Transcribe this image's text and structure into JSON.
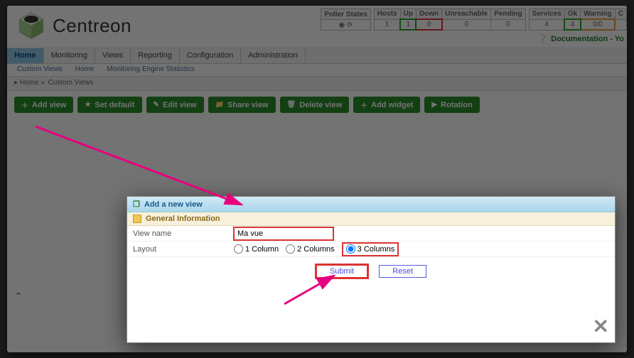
{
  "brand": "Centreon",
  "status": {
    "poller": {
      "header": "Poller States"
    },
    "hosts": {
      "h": "Hosts",
      "up": "Up",
      "down": "Down",
      "unreach": "Unreachable",
      "pending": "Pending",
      "v_hosts": "1",
      "v_up": "1",
      "v_down": "0",
      "v_unreach": "0",
      "v_pending": "0"
    },
    "svc": {
      "h": "Services",
      "ok": "Ok",
      "warn": "Warning",
      "crit": "C",
      "v_s": "4",
      "v_ok": "4",
      "v_warn": "0/0"
    }
  },
  "doclink": "Documentation - Yo",
  "nav": [
    "Home",
    "Monitoring",
    "Views",
    "Reporting",
    "Configuration",
    "Administration"
  ],
  "subnav": [
    "Custom Views",
    "Home",
    "Monitoring Engine Statistics"
  ],
  "crumb": {
    "a": "Home",
    "b": "Custom Views"
  },
  "toolbar": {
    "add": "Add view",
    "setdef": "Set default",
    "edit": "Edit view",
    "share": "Share view",
    "del": "Delete view",
    "addw": "Add widget",
    "rot": "Rotation"
  },
  "modal": {
    "title": "Add a new view",
    "section": "General Information",
    "viewname_lbl": "View name",
    "viewname_val": "Ma vue",
    "layout_lbl": "Layout",
    "opt1": "1 Column",
    "opt2": "2 Columns",
    "opt3": "3 Columns",
    "submit": "Submit",
    "reset": "Reset"
  }
}
